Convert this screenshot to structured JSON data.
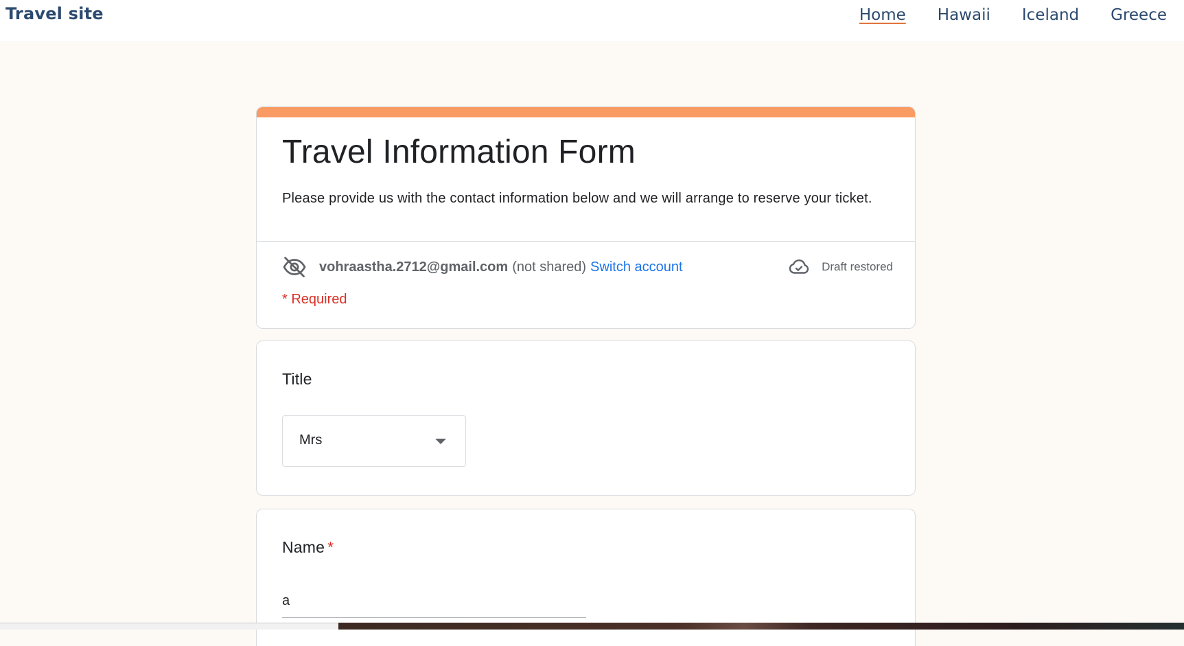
{
  "site": {
    "brand": "Travel site"
  },
  "nav": {
    "items": [
      {
        "label": "Home",
        "active": true
      },
      {
        "label": "Hawaii",
        "active": false
      },
      {
        "label": "Iceland",
        "active": false
      },
      {
        "label": "Greece",
        "active": false
      }
    ]
  },
  "form": {
    "accent_color": "#f99b63",
    "title": "Travel Information Form",
    "description": "Please provide us with the contact information below and we will arrange to reserve your ticket.",
    "account": {
      "icon": "eye-off-icon",
      "email": "vohraastha.2712@gmail.com",
      "not_shared": "(not shared)",
      "switch_label": "Switch account"
    },
    "draft": {
      "icon": "cloud-check-icon",
      "status": "Draft restored"
    },
    "required_note": "* Required",
    "questions": {
      "title": {
        "label": "Title",
        "selected": "Mrs"
      },
      "name": {
        "label": "Name",
        "required_mark": "*",
        "value": "a"
      }
    }
  }
}
